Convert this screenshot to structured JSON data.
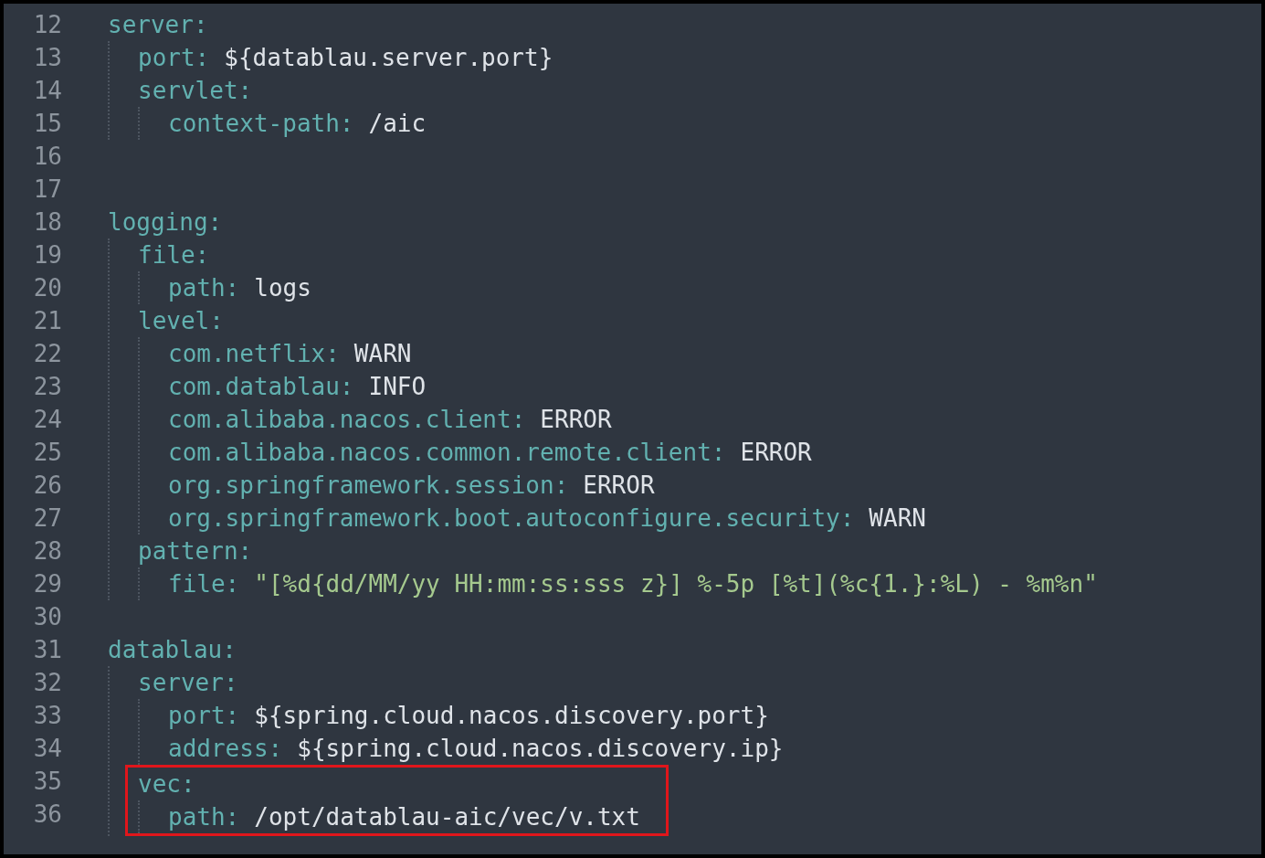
{
  "lines": [
    {
      "number": "12",
      "key": "server:",
      "highlighted": false,
      "children": [
        {
          "number": "13",
          "key": "port:",
          "value": "${datablau.server.port}",
          "kind": "plain",
          "highlighted": false
        },
        {
          "number": "14",
          "key": "servlet:",
          "highlighted": false,
          "children": [
            {
              "number": "15",
              "key": "context-path:",
              "value": "/aic",
              "kind": "plain",
              "highlighted": false
            }
          ]
        }
      ]
    },
    {
      "number": "16"
    },
    {
      "number": "17"
    },
    {
      "number": "18",
      "key": "logging:",
      "highlighted": false,
      "children": [
        {
          "number": "19",
          "key": "file:",
          "highlighted": false,
          "children": [
            {
              "number": "20",
              "key": "path:",
              "value": "logs",
              "kind": "plain",
              "highlighted": false
            }
          ]
        },
        {
          "number": "21",
          "key": "level:",
          "highlighted": false,
          "children": [
            {
              "number": "22",
              "key": "com.netflix:",
              "value": "WARN",
              "kind": "plain",
              "highlighted": false
            },
            {
              "number": "23",
              "key": "com.datablau:",
              "value": "INFO",
              "kind": "plain",
              "highlighted": false
            },
            {
              "number": "24",
              "key": "com.alibaba.nacos.client:",
              "value": "ERROR",
              "kind": "plain",
              "highlighted": false
            },
            {
              "number": "25",
              "key": "com.alibaba.nacos.common.remote.client:",
              "value": "ERROR",
              "kind": "plain",
              "highlighted": false
            },
            {
              "number": "26",
              "key": "org.springframework.session:",
              "value": "ERROR",
              "kind": "plain",
              "highlighted": false
            },
            {
              "number": "27",
              "key": "org.springframework.boot.autoconfigure.security:",
              "value": "WARN",
              "kind": "plain",
              "highlighted": false
            }
          ]
        },
        {
          "number": "28",
          "key": "pattern:",
          "highlighted": false,
          "children": [
            {
              "number": "29",
              "key": "file:",
              "value": "\"[%d{dd/MM/yy HH:mm:ss:sss z}] %-5p [%t](%c{1.}:%L) - %m%n\"",
              "kind": "string",
              "highlighted": false
            }
          ]
        }
      ]
    },
    {
      "number": "30"
    },
    {
      "number": "31",
      "key": "datablau:",
      "highlighted": false,
      "children": [
        {
          "number": "32",
          "key": "server:",
          "highlighted": false,
          "children": [
            {
              "number": "33",
              "key": "port:",
              "value": "${spring.cloud.nacos.discovery.port}",
              "kind": "plain",
              "highlighted": false
            },
            {
              "number": "34",
              "key": "address:",
              "value": "${spring.cloud.nacos.discovery.ip}",
              "kind": "plain",
              "highlighted": false
            }
          ]
        },
        {
          "number": "35",
          "key": "vec:",
          "highlighted": true,
          "children": [
            {
              "number": "36",
              "key": "path:",
              "value": "/opt/datablau-aic/vec/v.txt",
              "kind": "plain",
              "highlighted": false
            }
          ]
        }
      ]
    }
  ]
}
